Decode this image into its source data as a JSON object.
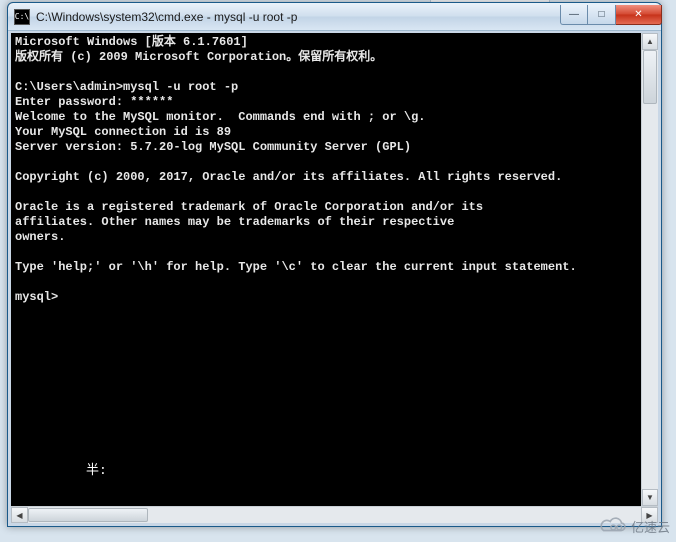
{
  "bg": {
    "dummy": ""
  },
  "titlebar": {
    "icon_text": "C:\\",
    "title": "C:\\Windows\\system32\\cmd.exe - mysql  -u root -p"
  },
  "win_buttons": {
    "minimize": "—",
    "maximize": "□",
    "close": "✕"
  },
  "terminal": {
    "lines": "Microsoft Windows [版本 6.1.7601]\n版权所有 (c) 2009 Microsoft Corporation。保留所有权利。\n\nC:\\Users\\admin>mysql -u root -p\nEnter password: ******\nWelcome to the MySQL monitor.  Commands end with ; or \\g.\nYour MySQL connection id is 89\nServer version: 5.7.20-log MySQL Community Server (GPL)\n\nCopyright (c) 2000, 2017, Oracle and/or its affiliates. All rights reserved.\n\nOracle is a registered trademark of Oracle Corporation and/or its\naffiliates. Other names may be trademarks of their respective\nowners.\n\nType 'help;' or '\\h' for help. Type '\\c' to clear the current input statement.\n\nmysql>",
    "ime": "半:"
  },
  "scroll": {
    "up": "▲",
    "down": "▼",
    "left": "◀",
    "right": "▶"
  },
  "watermark": {
    "text": "亿速云"
  }
}
